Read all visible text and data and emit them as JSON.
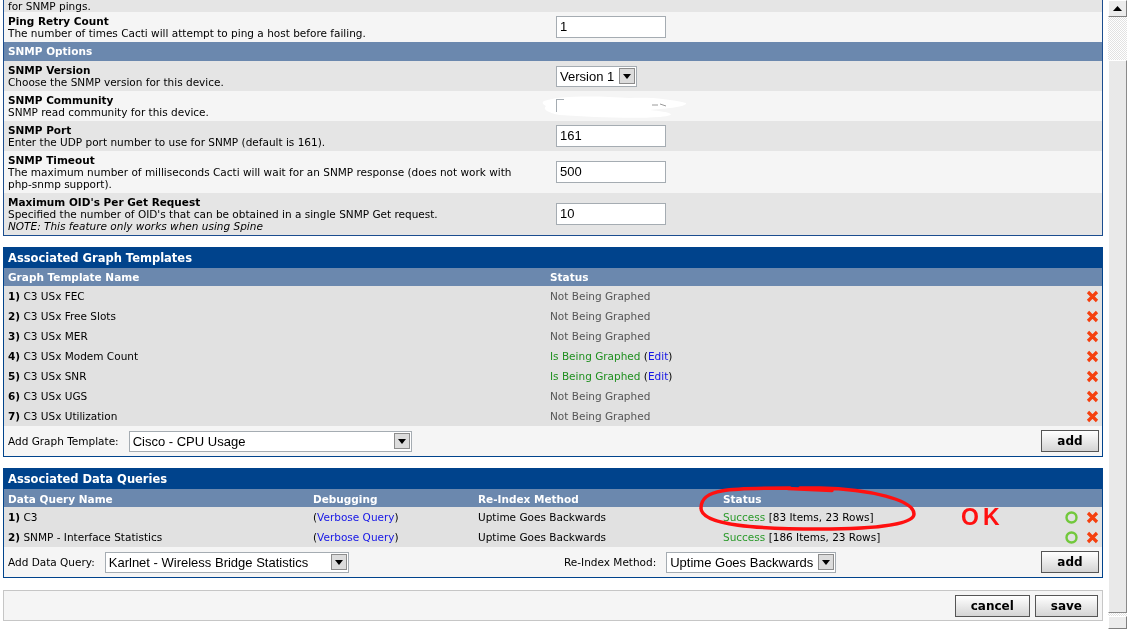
{
  "settings": [
    {
      "kind": "note",
      "description": "for SNMP pings."
    },
    {
      "kind": "input",
      "label": "Ping Retry Count",
      "description": "The number of times Cacti will attempt to ping a host before failing.",
      "value": "1",
      "redacted": false
    },
    {
      "kind": "header",
      "label": "SNMP Options"
    },
    {
      "kind": "select",
      "label": "SNMP Version",
      "description": "Choose the SNMP version for this device.",
      "value": "Version 1"
    },
    {
      "kind": "input",
      "label": "SNMP Community",
      "description": "SNMP read community for this device.",
      "redacted": true
    },
    {
      "kind": "input",
      "label": "SNMP Port",
      "description": "Enter the UDP port number to use for SNMP (default is 161).",
      "value": "161",
      "redacted": false
    },
    {
      "kind": "input",
      "label": "SNMP Timeout",
      "description": "The maximum number of milliseconds Cacti will wait for an SNMP response (does not work with php-snmp support).",
      "value": "500",
      "redacted": false
    },
    {
      "kind": "input",
      "label": "Maximum OID's Per Get Request",
      "description": "Specified the number of OID's that can be obtained in a single SNMP Get request.",
      "note": "NOTE: This feature only works when using Spine",
      "value": "10",
      "redacted": false
    }
  ],
  "graph_templates": {
    "title": "Associated Graph Templates",
    "columns": [
      "Graph Template Name",
      "Status"
    ],
    "rows": [
      {
        "name": "**1)** C3 USx FEC",
        "status": "Not Being Graphed",
        "graphed": false
      },
      {
        "name": "**2)** C3 USx Free Slots",
        "status": "Not Being Graphed",
        "graphed": false
      },
      {
        "name": "**3)** C3 USx MER",
        "status": "Not Being Graphed",
        "graphed": false
      },
      {
        "name": "**4)** C3 USx Modem Count",
        "status": "Is Being Graphed",
        "graphed": true,
        "edit_link": "(Edit)"
      },
      {
        "name": "**5)** C3 USx SNR",
        "status": "Is Being Graphed",
        "graphed": true,
        "edit_link": "(Edit)"
      },
      {
        "name": "**6)** C3 USx UGS",
        "status": "Not Being Graphed",
        "graphed": false
      },
      {
        "name": "**7)** C3 USx Utilization",
        "status": "Not Being Graphed",
        "graphed": false
      }
    ],
    "add_label": "Add Graph Template:",
    "add_select": "Cisco - CPU Usage",
    "add_button": "add"
  },
  "data_queries": {
    "title": "Associated Data Queries",
    "columns": [
      "Data Query Name",
      "Debugging",
      "Re-Index Method",
      "Status"
    ],
    "rows": [
      {
        "name": "**1)** C3",
        "debug_link": "(Verbose Query)",
        "reindex": "Uptime Goes Backwards",
        "result": "Success",
        "success": true,
        "detail": "[83 Items, 23 Rows]"
      },
      {
        "name": "**2)** SNMP - Interface Statistics",
        "debug_link": "(Verbose Query)",
        "reindex": "Uptime Goes Backwards",
        "result": "Success",
        "success": true,
        "detail": "[186 Items, 23 Rows]"
      }
    ],
    "add_label": "Add Data Query:",
    "add_select": "Karlnet - Wireless Bridge Statistics",
    "reindex_label": "Re-Index Method:",
    "reindex_select": "Uptime Goes Backwards",
    "add_button": "add"
  },
  "annotation": {
    "text": "OK"
  },
  "buttons": [
    "cancel",
    "save"
  ]
}
